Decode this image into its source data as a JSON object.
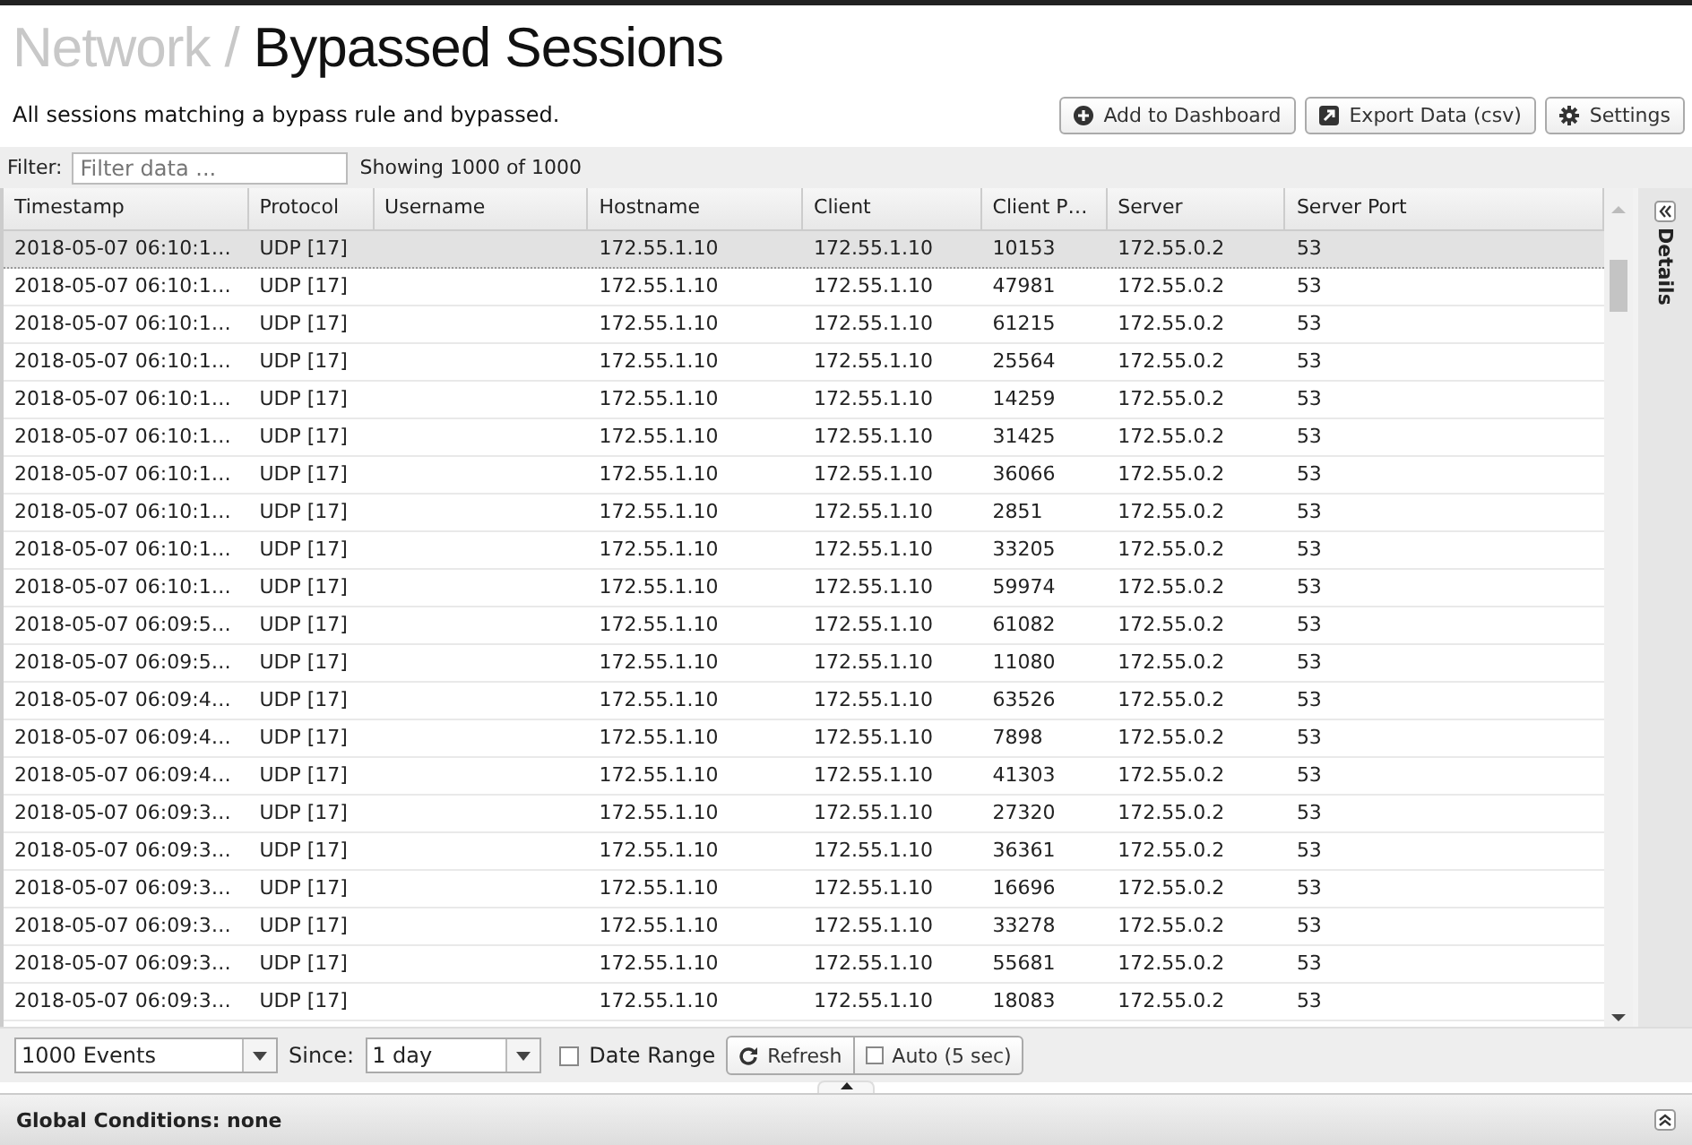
{
  "breadcrumb": {
    "parent": "Network /",
    "title": "Bypassed Sessions"
  },
  "description": "All sessions matching a bypass rule and bypassed.",
  "actions": [
    {
      "label": "Add to Dashboard",
      "kind": "add"
    },
    {
      "label": "Export Data (csv)",
      "kind": "export"
    },
    {
      "label": "Settings",
      "kind": "settings"
    }
  ],
  "filter": {
    "label": "Filter:",
    "placeholder": "Filter data ...",
    "count": "Showing 1000 of 1000"
  },
  "table": {
    "columns": [
      "Timestamp",
      "Protocol",
      "Username",
      "Hostname",
      "Client",
      "Client P…",
      "Server",
      "Server Port"
    ],
    "rows": [
      {
        "selected": true,
        "timestamp": "2018-05-07 06:10:1…",
        "protocol": "UDP [17]",
        "hostname": "172.55.1.10",
        "client": "172.55.1.10",
        "client_port": "10153",
        "server": "172.55.0.2",
        "server_port": "53"
      },
      {
        "selected": false,
        "timestamp": "2018-05-07 06:10:1…",
        "protocol": "UDP [17]",
        "hostname": "172.55.1.10",
        "client": "172.55.1.10",
        "client_port": "47981",
        "server": "172.55.0.2",
        "server_port": "53"
      },
      {
        "selected": false,
        "timestamp": "2018-05-07 06:10:1…",
        "protocol": "UDP [17]",
        "hostname": "172.55.1.10",
        "client": "172.55.1.10",
        "client_port": "61215",
        "server": "172.55.0.2",
        "server_port": "53"
      },
      {
        "selected": false,
        "timestamp": "2018-05-07 06:10:1…",
        "protocol": "UDP [17]",
        "hostname": "172.55.1.10",
        "client": "172.55.1.10",
        "client_port": "25564",
        "server": "172.55.0.2",
        "server_port": "53"
      },
      {
        "selected": false,
        "timestamp": "2018-05-07 06:10:1…",
        "protocol": "UDP [17]",
        "hostname": "172.55.1.10",
        "client": "172.55.1.10",
        "client_port": "14259",
        "server": "172.55.0.2",
        "server_port": "53"
      },
      {
        "selected": false,
        "timestamp": "2018-05-07 06:10:1…",
        "protocol": "UDP [17]",
        "hostname": "172.55.1.10",
        "client": "172.55.1.10",
        "client_port": "31425",
        "server": "172.55.0.2",
        "server_port": "53"
      },
      {
        "selected": false,
        "timestamp": "2018-05-07 06:10:1…",
        "protocol": "UDP [17]",
        "hostname": "172.55.1.10",
        "client": "172.55.1.10",
        "client_port": "36066",
        "server": "172.55.0.2",
        "server_port": "53"
      },
      {
        "selected": false,
        "timestamp": "2018-05-07 06:10:1…",
        "protocol": "UDP [17]",
        "hostname": "172.55.1.10",
        "client": "172.55.1.10",
        "client_port": "2851",
        "server": "172.55.0.2",
        "server_port": "53"
      },
      {
        "selected": false,
        "timestamp": "2018-05-07 06:10:1…",
        "protocol": "UDP [17]",
        "hostname": "172.55.1.10",
        "client": "172.55.1.10",
        "client_port": "33205",
        "server": "172.55.0.2",
        "server_port": "53"
      },
      {
        "selected": false,
        "timestamp": "2018-05-07 06:10:1…",
        "protocol": "UDP [17]",
        "hostname": "172.55.1.10",
        "client": "172.55.1.10",
        "client_port": "59974",
        "server": "172.55.0.2",
        "server_port": "53"
      },
      {
        "selected": false,
        "timestamp": "2018-05-07 06:09:5…",
        "protocol": "UDP [17]",
        "hostname": "172.55.1.10",
        "client": "172.55.1.10",
        "client_port": "61082",
        "server": "172.55.0.2",
        "server_port": "53"
      },
      {
        "selected": false,
        "timestamp": "2018-05-07 06:09:5…",
        "protocol": "UDP [17]",
        "hostname": "172.55.1.10",
        "client": "172.55.1.10",
        "client_port": "11080",
        "server": "172.55.0.2",
        "server_port": "53"
      },
      {
        "selected": false,
        "timestamp": "2018-05-07 06:09:4…",
        "protocol": "UDP [17]",
        "hostname": "172.55.1.10",
        "client": "172.55.1.10",
        "client_port": "63526",
        "server": "172.55.0.2",
        "server_port": "53"
      },
      {
        "selected": false,
        "timestamp": "2018-05-07 06:09:4…",
        "protocol": "UDP [17]",
        "hostname": "172.55.1.10",
        "client": "172.55.1.10",
        "client_port": "7898",
        "server": "172.55.0.2",
        "server_port": "53"
      },
      {
        "selected": false,
        "timestamp": "2018-05-07 06:09:4…",
        "protocol": "UDP [17]",
        "hostname": "172.55.1.10",
        "client": "172.55.1.10",
        "client_port": "41303",
        "server": "172.55.0.2",
        "server_port": "53"
      },
      {
        "selected": false,
        "timestamp": "2018-05-07 06:09:3…",
        "protocol": "UDP [17]",
        "hostname": "172.55.1.10",
        "client": "172.55.1.10",
        "client_port": "27320",
        "server": "172.55.0.2",
        "server_port": "53"
      },
      {
        "selected": false,
        "timestamp": "2018-05-07 06:09:3…",
        "protocol": "UDP [17]",
        "hostname": "172.55.1.10",
        "client": "172.55.1.10",
        "client_port": "36361",
        "server": "172.55.0.2",
        "server_port": "53"
      },
      {
        "selected": false,
        "timestamp": "2018-05-07 06:09:3…",
        "protocol": "UDP [17]",
        "hostname": "172.55.1.10",
        "client": "172.55.1.10",
        "client_port": "16696",
        "server": "172.55.0.2",
        "server_port": "53"
      },
      {
        "selected": false,
        "timestamp": "2018-05-07 06:09:3…",
        "protocol": "UDP [17]",
        "hostname": "172.55.1.10",
        "client": "172.55.1.10",
        "client_port": "33278",
        "server": "172.55.0.2",
        "server_port": "53"
      },
      {
        "selected": false,
        "timestamp": "2018-05-07 06:09:3…",
        "protocol": "UDP [17]",
        "hostname": "172.55.1.10",
        "client": "172.55.1.10",
        "client_port": "55681",
        "server": "172.55.0.2",
        "server_port": "53"
      },
      {
        "selected": false,
        "timestamp": "2018-05-07 06:09:3…",
        "protocol": "UDP [17]",
        "hostname": "172.55.1.10",
        "client": "172.55.1.10",
        "client_port": "18083",
        "server": "172.55.0.2",
        "server_port": "53"
      }
    ]
  },
  "details_panel": {
    "label": "Details"
  },
  "toolbar": {
    "limit": "1000 Events",
    "since_label": "Since:",
    "since": "1 day",
    "date_range": {
      "label": "Date Range",
      "checked": false
    },
    "refresh": "Refresh",
    "auto": {
      "label": "Auto (5 sec)",
      "checked": false
    }
  },
  "global_conditions": "Global Conditions: none"
}
